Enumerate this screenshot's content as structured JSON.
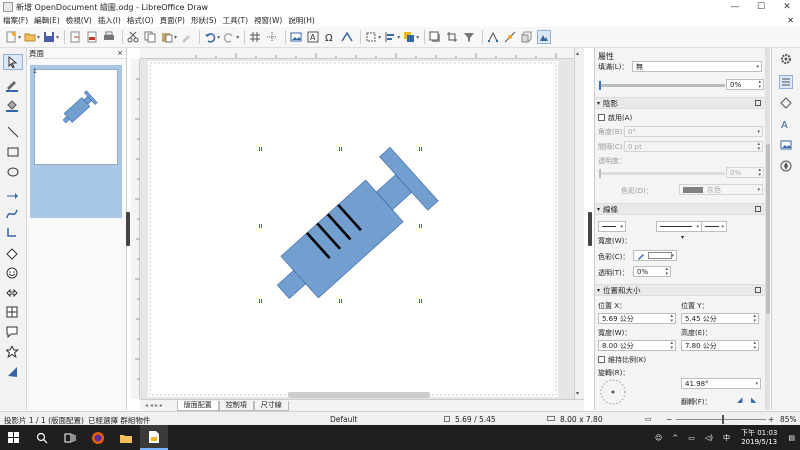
{
  "window": {
    "title": "新增 OpenDocument 繪圖.odg - LibreOffice Draw",
    "minimize": "—",
    "maximize": "☐",
    "close": "✕"
  },
  "menu": [
    "檔案(F)",
    "編輯(E)",
    "檢視(V)",
    "插入(I)",
    "格式(O)",
    "頁面(P)",
    "形狀(S)",
    "工具(T)",
    "視窗(W)",
    "說明(H)"
  ],
  "menu_close": "✕",
  "slide_pane": {
    "title": "頁面",
    "close": "×",
    "slide_number": "1"
  },
  "tabs": {
    "nav": "◂ ◂ ▸ ▸",
    "items": [
      "版面配置",
      "控制項",
      "尺寸線"
    ],
    "active": 0
  },
  "sidebar": {
    "properties_title": "屬性",
    "area_fill_label": "填滿(L)：",
    "area_fill_value": "無",
    "transparency_value": "0%",
    "shadow": {
      "title": "陰影",
      "enable_label": "啟用(A)",
      "angle_label": "角度(B)：",
      "angle_value": "0°",
      "distance_label": "間隔(C)：",
      "distance_value": "0 pt",
      "transparency_label": "透明度：",
      "transparency_value": "0%",
      "color_label": "色彩(D)：",
      "color_value": "灰色"
    },
    "line": {
      "title": "線條",
      "width_label": "寬度(W)：",
      "color_label": "色彩(C)：",
      "transparency_label": "透明(T)：",
      "transparency_value": "0%"
    },
    "position": {
      "title": "位置和大小",
      "pos_x_label": "位置 X：",
      "pos_x_value": "5.69 公分",
      "pos_y_label": "位置 Y：",
      "pos_y_value": "5.45 公分",
      "width_label": "寬度(W)：",
      "width_value": "8.00 公分",
      "height_label": "高度(E)：",
      "height_value": "7.80 公分",
      "keep_ratio_label": "維持比例(K)",
      "rotation_label": "旋轉(R)：",
      "rotation_value": "41.98°",
      "flip_label": "翻轉(F)："
    }
  },
  "status": {
    "slide": "投影片 1 / 1 (版面配置)",
    "selection": "已經選擇 群組物件",
    "master": "Default",
    "position": "5.69 / 5.45",
    "size": "8.00 x 7.80",
    "zoom": "85%"
  },
  "taskbar": {
    "time": "下午 01:03",
    "date": "2019/5/13",
    "ime": "中",
    "search_icon": "search-icon"
  },
  "colors": {
    "shape_fill": "#729fcf",
    "shape_stroke": "#3465a4",
    "accent": "#3a6fd0"
  }
}
